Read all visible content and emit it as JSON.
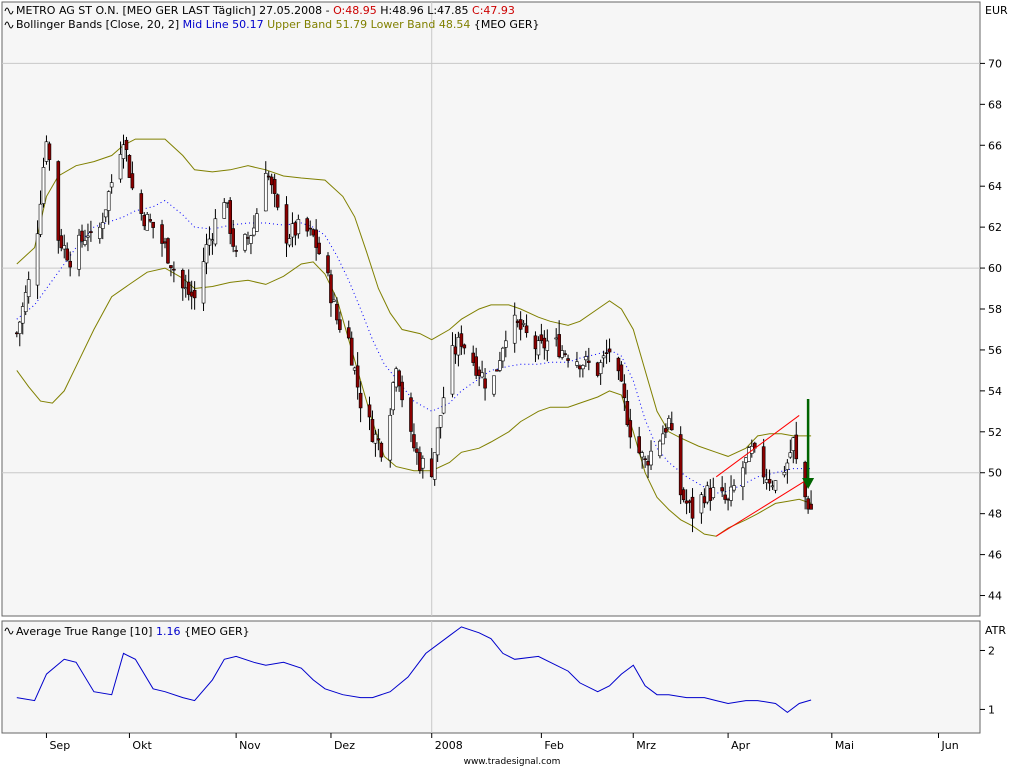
{
  "main_legend": {
    "line1": {
      "name": "METRO AG ST O.N. [MEO GER LAST Täglich] 27.05.2008 - ",
      "open": "O:48.95",
      "high": " H:48.96",
      "low": " L:47.85",
      "close": " C:47.93"
    },
    "line2": {
      "indicator": "Bollinger Bands [Close, 20, 2]",
      "mid": " Mid Line 50.17",
      "upper": " Upper Band 51.79",
      "lower": " Lower Band 48.54",
      "symbol": " {MEO GER}"
    }
  },
  "atr_legend": {
    "name": "Average True Range [10]",
    "value": " 1.16",
    "symbol": " {MEO GER}"
  },
  "footer": "www.tradesignal.com",
  "colors": {
    "price_up": "#ffffff",
    "price_down": "#8b0000",
    "upper_band": "#808000",
    "lower_band": "#808000",
    "mid_line": "#0000ff",
    "atr": "#0000cc",
    "channel": "#ff0000",
    "arrow": "#006400",
    "grid": "#c8c8c8",
    "panel_bg": "#f6f6f6"
  },
  "chart_data": [
    {
      "type": "candlestick",
      "title": "METRO AG ST O.N. [MEO GER LAST Täglich]",
      "unit": "EUR",
      "ylim": [
        43,
        73
      ],
      "yticks": [
        44,
        46,
        48,
        50,
        52,
        54,
        56,
        58,
        60,
        62,
        64,
        66,
        68,
        70
      ],
      "x_labels": [
        "Sep",
        "Okt",
        "Nov",
        "Dez",
        "2008",
        "Feb",
        "Mrz",
        "Apr",
        "Mai",
        "Jun"
      ],
      "x_label_day": [
        10,
        38,
        74,
        106,
        140,
        177,
        208,
        240,
        275,
        311
      ],
      "x_range_days": [
        -5,
        325
      ],
      "grid": true,
      "anchors_close": [
        [
          0,
          56.8
        ],
        [
          6,
          60.5
        ],
        [
          10,
          66.5
        ],
        [
          14,
          61.5
        ],
        [
          18,
          60.5
        ],
        [
          24,
          61.8
        ],
        [
          26,
          60.8
        ],
        [
          36,
          66.5
        ],
        [
          40,
          63.0
        ],
        [
          46,
          62.0
        ],
        [
          50,
          61.0
        ],
        [
          56,
          59.0
        ],
        [
          60,
          58.5
        ],
        [
          64,
          61.0
        ],
        [
          70,
          63.5
        ],
        [
          74,
          60.5
        ],
        [
          80,
          62.0
        ],
        [
          84,
          65.0
        ],
        [
          90,
          61.5
        ],
        [
          96,
          62.0
        ],
        [
          100,
          61.5
        ],
        [
          104,
          60.0
        ],
        [
          108,
          57.5
        ],
        [
          112,
          56.5
        ],
        [
          116,
          53.5
        ],
        [
          120,
          52.0
        ],
        [
          124,
          51.0
        ],
        [
          128,
          55.5
        ],
        [
          132,
          52.0
        ],
        [
          136,
          50.5
        ],
        [
          140,
          50.2
        ],
        [
          146,
          55.5
        ],
        [
          150,
          56.5
        ],
        [
          156,
          55.0
        ],
        [
          160,
          54.0
        ],
        [
          166,
          57.5
        ],
        [
          170,
          57.0
        ],
        [
          176,
          56.0
        ],
        [
          180,
          56.5
        ],
        [
          184,
          56.0
        ],
        [
          190,
          55.5
        ],
        [
          196,
          55.0
        ],
        [
          200,
          56.0
        ],
        [
          204,
          54.0
        ],
        [
          208,
          51.5
        ],
        [
          212,
          50.5
        ],
        [
          216,
          51.5
        ],
        [
          220,
          52.5
        ],
        [
          224,
          49.0
        ],
        [
          228,
          48.0
        ],
        [
          232,
          49.0
        ],
        [
          236,
          49.0
        ],
        [
          240,
          48.5
        ],
        [
          244,
          50.0
        ],
        [
          248,
          51.0
        ],
        [
          252,
          50.0
        ],
        [
          256,
          49.5
        ],
        [
          260,
          50.5
        ],
        [
          262,
          51.5
        ],
        [
          264,
          49.5
        ],
        [
          266,
          48.8
        ],
        [
          268,
          48.2
        ]
      ],
      "upper_band": [
        [
          0,
          60.2
        ],
        [
          6,
          61.0
        ],
        [
          10,
          63.5
        ],
        [
          14,
          64.5
        ],
        [
          20,
          65.0
        ],
        [
          26,
          65.2
        ],
        [
          32,
          65.5
        ],
        [
          36,
          66.0
        ],
        [
          40,
          66.3
        ],
        [
          50,
          66.3
        ],
        [
          56,
          65.5
        ],
        [
          60,
          64.8
        ],
        [
          66,
          64.7
        ],
        [
          72,
          64.8
        ],
        [
          78,
          65.0
        ],
        [
          84,
          64.8
        ],
        [
          90,
          64.5
        ],
        [
          96,
          64.4
        ],
        [
          104,
          64.3
        ],
        [
          110,
          63.5
        ],
        [
          114,
          62.5
        ],
        [
          118,
          60.8
        ],
        [
          122,
          59.0
        ],
        [
          126,
          57.8
        ],
        [
          130,
          57.0
        ],
        [
          136,
          56.8
        ],
        [
          140,
          56.5
        ],
        [
          146,
          57.0
        ],
        [
          150,
          57.5
        ],
        [
          156,
          58.0
        ],
        [
          160,
          58.2
        ],
        [
          166,
          58.2
        ],
        [
          170,
          58.0
        ],
        [
          176,
          57.6
        ],
        [
          180,
          57.4
        ],
        [
          186,
          57.2
        ],
        [
          190,
          57.4
        ],
        [
          196,
          58.0
        ],
        [
          200,
          58.4
        ],
        [
          204,
          58.0
        ],
        [
          208,
          57.0
        ],
        [
          212,
          55.0
        ],
        [
          216,
          53.0
        ],
        [
          220,
          52.0
        ],
        [
          224,
          51.7
        ],
        [
          230,
          51.3
        ],
        [
          236,
          51.0
        ],
        [
          240,
          50.8
        ],
        [
          246,
          51.2
        ],
        [
          250,
          51.8
        ],
        [
          254,
          51.9
        ],
        [
          258,
          51.9
        ],
        [
          262,
          51.8
        ],
        [
          268,
          51.8
        ]
      ],
      "lower_band": [
        [
          0,
          55.0
        ],
        [
          4,
          54.2
        ],
        [
          8,
          53.5
        ],
        [
          12,
          53.4
        ],
        [
          16,
          54.0
        ],
        [
          20,
          55.2
        ],
        [
          26,
          57.0
        ],
        [
          32,
          58.6
        ],
        [
          38,
          59.2
        ],
        [
          44,
          59.8
        ],
        [
          50,
          60.0
        ],
        [
          56,
          59.5
        ],
        [
          60,
          59.0
        ],
        [
          66,
          59.1
        ],
        [
          72,
          59.3
        ],
        [
          78,
          59.4
        ],
        [
          84,
          59.2
        ],
        [
          90,
          59.6
        ],
        [
          96,
          60.2
        ],
        [
          100,
          60.3
        ],
        [
          104,
          59.7
        ],
        [
          108,
          58.5
        ],
        [
          112,
          56.5
        ],
        [
          116,
          54.5
        ],
        [
          120,
          52.5
        ],
        [
          124,
          50.8
        ],
        [
          128,
          50.3
        ],
        [
          134,
          50.1
        ],
        [
          140,
          50.1
        ],
        [
          146,
          50.5
        ],
        [
          150,
          51.0
        ],
        [
          156,
          51.2
        ],
        [
          160,
          51.5
        ],
        [
          166,
          52.0
        ],
        [
          170,
          52.5
        ],
        [
          176,
          53.0
        ],
        [
          180,
          53.2
        ],
        [
          186,
          53.2
        ],
        [
          190,
          53.4
        ],
        [
          196,
          53.7
        ],
        [
          200,
          54.0
        ],
        [
          204,
          53.8
        ],
        [
          208,
          52.0
        ],
        [
          212,
          50.0
        ],
        [
          216,
          48.8
        ],
        [
          220,
          48.2
        ],
        [
          224,
          47.7
        ],
        [
          228,
          47.4
        ],
        [
          232,
          47.0
        ],
        [
          236,
          46.9
        ],
        [
          240,
          47.3
        ],
        [
          246,
          47.7
        ],
        [
          250,
          48.0
        ],
        [
          256,
          48.5
        ],
        [
          260,
          48.6
        ],
        [
          264,
          48.7
        ],
        [
          268,
          48.5
        ]
      ],
      "mid_line": [
        [
          0,
          57.5
        ],
        [
          6,
          58.2
        ],
        [
          10,
          59.0
        ],
        [
          14,
          59.8
        ],
        [
          20,
          61.0
        ],
        [
          26,
          62.0
        ],
        [
          32,
          62.3
        ],
        [
          36,
          62.5
        ],
        [
          40,
          62.8
        ],
        [
          46,
          63.0
        ],
        [
          50,
          63.3
        ],
        [
          56,
          62.6
        ],
        [
          60,
          62.0
        ],
        [
          66,
          61.9
        ],
        [
          72,
          62.1
        ],
        [
          78,
          62.2
        ],
        [
          84,
          62.2
        ],
        [
          90,
          62.1
        ],
        [
          96,
          62.2
        ],
        [
          100,
          62.0
        ],
        [
          104,
          61.6
        ],
        [
          108,
          60.6
        ],
        [
          112,
          59.4
        ],
        [
          116,
          58.0
        ],
        [
          120,
          56.5
        ],
        [
          124,
          55.3
        ],
        [
          128,
          54.6
        ],
        [
          134,
          53.5
        ],
        [
          140,
          53.0
        ],
        [
          146,
          53.4
        ],
        [
          150,
          54.0
        ],
        [
          156,
          54.6
        ],
        [
          160,
          55.0
        ],
        [
          166,
          55.2
        ],
        [
          170,
          55.3
        ],
        [
          176,
          55.3
        ],
        [
          180,
          55.4
        ],
        [
          186,
          55.4
        ],
        [
          190,
          55.6
        ],
        [
          196,
          55.8
        ],
        [
          200,
          56.0
        ],
        [
          204,
          55.7
        ],
        [
          208,
          54.5
        ],
        [
          212,
          52.6
        ],
        [
          216,
          51.2
        ],
        [
          220,
          50.5
        ],
        [
          226,
          49.8
        ],
        [
          232,
          49.3
        ],
        [
          236,
          49.0
        ],
        [
          240,
          49.1
        ],
        [
          246,
          49.5
        ],
        [
          250,
          49.8
        ],
        [
          256,
          50.0
        ],
        [
          262,
          50.2
        ],
        [
          268,
          50.2
        ]
      ],
      "trend_channel": {
        "upper": [
          [
            236,
            49.8
          ],
          [
            264,
            52.8
          ]
        ],
        "lower": [
          [
            236,
            46.9
          ],
          [
            266,
            49.6
          ]
        ]
      },
      "arrow": {
        "from": [
          267,
          53.6
        ],
        "to": [
          267,
          49.3
        ]
      }
    },
    {
      "type": "line",
      "title": "Average True Range [10]",
      "unit": "ATR",
      "ylim": [
        0.6,
        2.5
      ],
      "yticks": [
        1,
        2
      ],
      "series": [
        {
          "name": "Average True Range [10]",
          "points": [
            [
              0,
              1.2
            ],
            [
              6,
              1.15
            ],
            [
              10,
              1.6
            ],
            [
              16,
              1.85
            ],
            [
              20,
              1.8
            ],
            [
              26,
              1.3
            ],
            [
              32,
              1.25
            ],
            [
              36,
              1.95
            ],
            [
              40,
              1.85
            ],
            [
              46,
              1.35
            ],
            [
              50,
              1.3
            ],
            [
              56,
              1.2
            ],
            [
              60,
              1.15
            ],
            [
              66,
              1.5
            ],
            [
              70,
              1.85
            ],
            [
              74,
              1.9
            ],
            [
              80,
              1.8
            ],
            [
              84,
              1.75
            ],
            [
              90,
              1.8
            ],
            [
              96,
              1.7
            ],
            [
              100,
              1.5
            ],
            [
              104,
              1.35
            ],
            [
              110,
              1.25
            ],
            [
              116,
              1.2
            ],
            [
              120,
              1.2
            ],
            [
              126,
              1.3
            ],
            [
              132,
              1.55
            ],
            [
              138,
              1.95
            ],
            [
              146,
              2.25
            ],
            [
              150,
              2.4
            ],
            [
              156,
              2.3
            ],
            [
              160,
              2.2
            ],
            [
              164,
              1.95
            ],
            [
              168,
              1.85
            ],
            [
              176,
              1.9
            ],
            [
              180,
              1.8
            ],
            [
              186,
              1.65
            ],
            [
              190,
              1.45
            ],
            [
              196,
              1.3
            ],
            [
              200,
              1.4
            ],
            [
              204,
              1.6
            ],
            [
              208,
              1.75
            ],
            [
              212,
              1.4
            ],
            [
              216,
              1.25
            ],
            [
              220,
              1.25
            ],
            [
              226,
              1.2
            ],
            [
              232,
              1.2
            ],
            [
              236,
              1.15
            ],
            [
              240,
              1.1
            ],
            [
              246,
              1.15
            ],
            [
              250,
              1.15
            ],
            [
              256,
              1.1
            ],
            [
              260,
              0.95
            ],
            [
              264,
              1.1
            ],
            [
              268,
              1.16
            ]
          ]
        }
      ]
    }
  ]
}
